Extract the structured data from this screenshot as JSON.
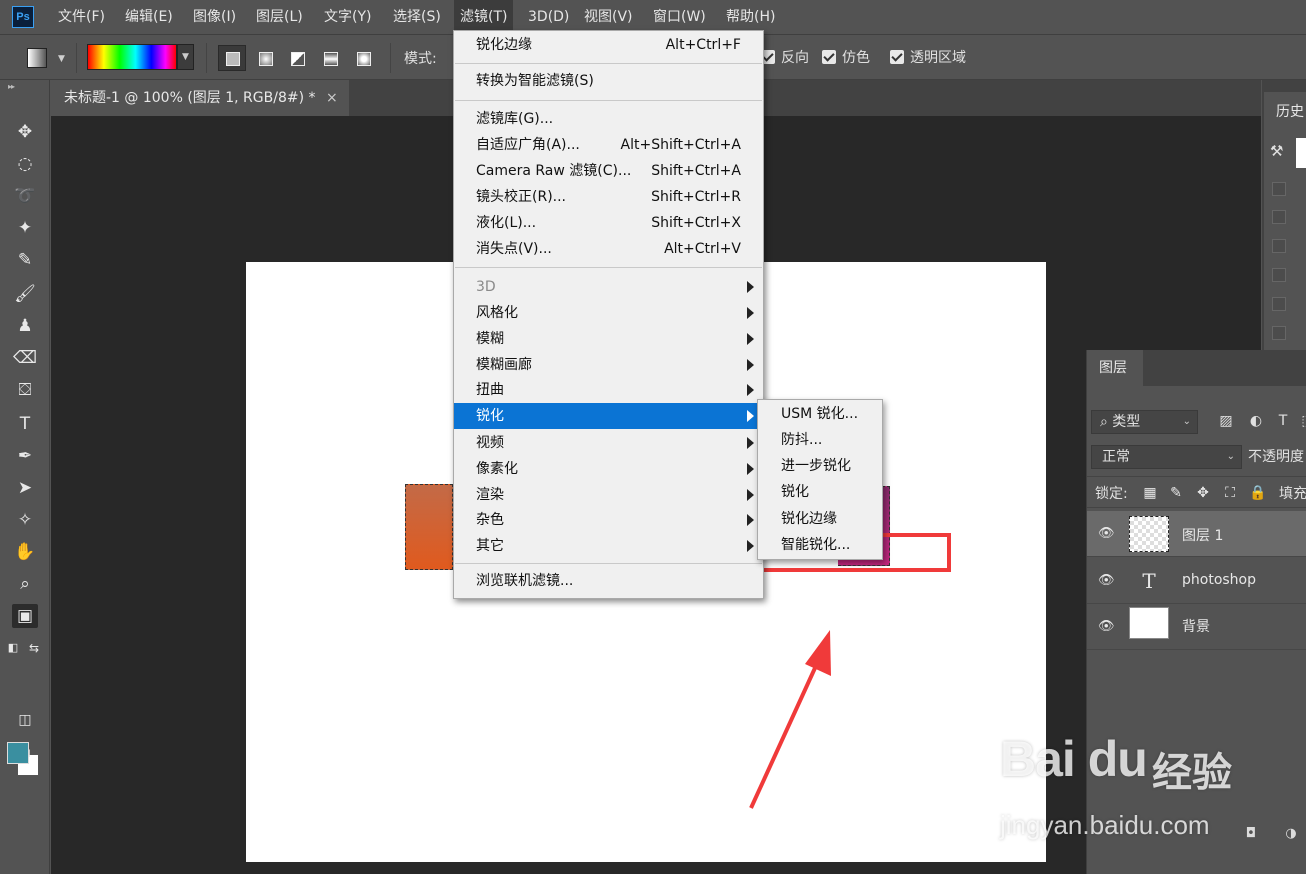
{
  "app": {
    "logo_text": "Ps"
  },
  "menubar": {
    "items": [
      {
        "label": "文件(F)"
      },
      {
        "label": "编辑(E)"
      },
      {
        "label": "图像(I)"
      },
      {
        "label": "图层(L)"
      },
      {
        "label": "文字(Y)"
      },
      {
        "label": "选择(S)"
      },
      {
        "label": "滤镜(T)",
        "active": true
      },
      {
        "label": "3D(D)"
      },
      {
        "label": "视图(V)"
      },
      {
        "label": "窗口(W)"
      },
      {
        "label": "帮助(H)"
      }
    ]
  },
  "options": {
    "mode_label": "模式:",
    "reverse_label": "反向",
    "dither_label": "仿色",
    "transparency_label": "透明区域",
    "gradient_colors": [
      "#ff0000",
      "#ffff00",
      "#00ff00",
      "#00ffff",
      "#0000ff",
      "#ff00ff"
    ]
  },
  "document": {
    "tab_title": "未标题-1 @ 100% (图层 1, RGB/8#) *",
    "close_glyph": "×"
  },
  "filter_menu": {
    "items": [
      {
        "label": "锐化边缘",
        "shortcut": "Alt+Ctrl+F"
      },
      {
        "label": "转换为智能滤镜(S)",
        "shortcut": ""
      },
      {
        "label": "滤镜库(G)...",
        "shortcut": ""
      },
      {
        "label": "自适应广角(A)...",
        "shortcut": "Alt+Shift+Ctrl+A"
      },
      {
        "label": "Camera Raw 滤镜(C)...",
        "shortcut": "Shift+Ctrl+A"
      },
      {
        "label": "镜头校正(R)...",
        "shortcut": "Shift+Ctrl+R"
      },
      {
        "label": "液化(L)...",
        "shortcut": "Shift+Ctrl+X"
      },
      {
        "label": "消失点(V)...",
        "shortcut": "Alt+Ctrl+V"
      },
      {
        "label": "3D",
        "submenu": true,
        "disabled": true
      },
      {
        "label": "风格化",
        "submenu": true
      },
      {
        "label": "模糊",
        "submenu": true
      },
      {
        "label": "模糊画廊",
        "submenu": true
      },
      {
        "label": "扭曲",
        "submenu": true
      },
      {
        "label": "锐化",
        "submenu": true,
        "highlighted": true
      },
      {
        "label": "视频",
        "submenu": true
      },
      {
        "label": "像素化",
        "submenu": true
      },
      {
        "label": "渲染",
        "submenu": true
      },
      {
        "label": "杂色",
        "submenu": true
      },
      {
        "label": "其它",
        "submenu": true
      },
      {
        "label": "浏览联机滤镜..."
      }
    ]
  },
  "sharpen_submenu": {
    "items": [
      {
        "label": "USM 锐化..."
      },
      {
        "label": "防抖..."
      },
      {
        "label": "进一步锐化"
      },
      {
        "label": "锐化"
      },
      {
        "label": "锐化边缘"
      },
      {
        "label": "智能锐化..."
      }
    ]
  },
  "history_panel": {
    "tab_label": "历史"
  },
  "layers_panel": {
    "tab_label": "图层",
    "filter_kind": "类型",
    "blend_mode": "正常",
    "opacity_label": "不透明度",
    "lock_label": "锁定:",
    "fill_label": "填充",
    "layers": [
      {
        "name": "图层 1",
        "selected": true
      },
      {
        "name": "photoshop"
      },
      {
        "name": "背景"
      }
    ]
  },
  "colors": {
    "foreground": "#3a8fa0",
    "background": "#ffffff",
    "menu_highlight": "#0b74d4",
    "annotation": "#f03a3a"
  },
  "watermark": {
    "logo": "Bai du",
    "brand": "经验",
    "url": "jingyan.baidu.com"
  }
}
